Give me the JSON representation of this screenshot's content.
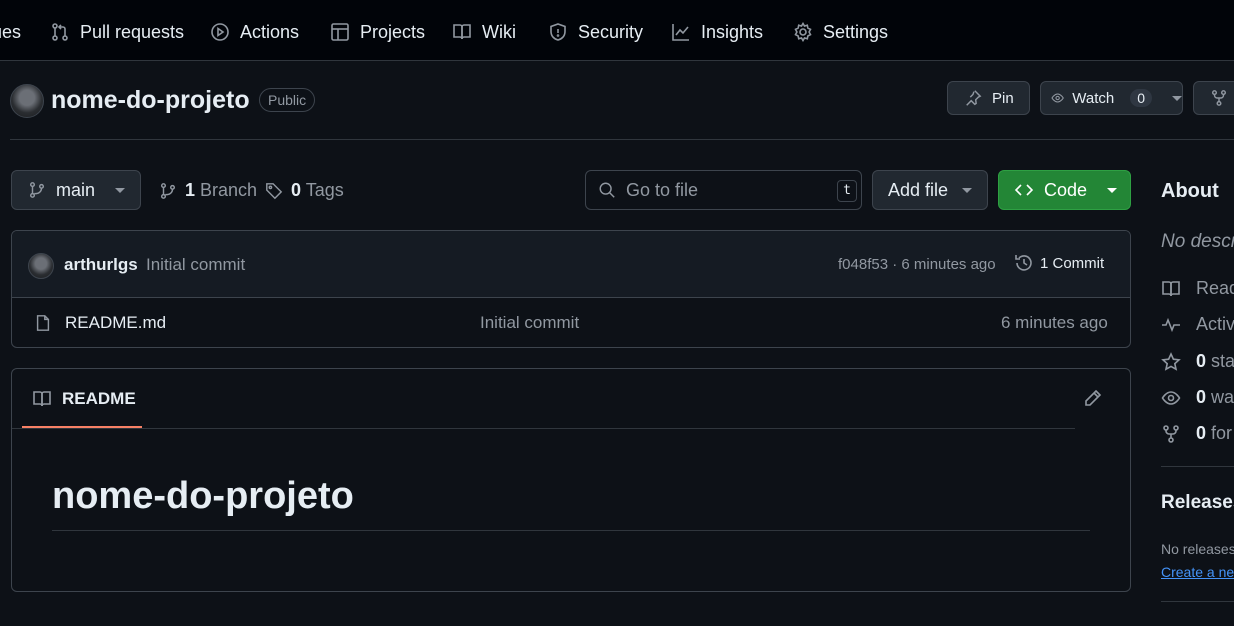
{
  "nav": {
    "items": [
      {
        "label": "ues",
        "icon": "issues-icon"
      },
      {
        "label": "Pull requests",
        "icon": "pull-request-icon"
      },
      {
        "label": "Actions",
        "icon": "play-icon"
      },
      {
        "label": "Projects",
        "icon": "table-icon"
      },
      {
        "label": "Wiki",
        "icon": "book-icon"
      },
      {
        "label": "Security",
        "icon": "shield-icon"
      },
      {
        "label": "Insights",
        "icon": "graph-icon"
      },
      {
        "label": "Settings",
        "icon": "gear-icon"
      }
    ]
  },
  "repo": {
    "name": "nome-do-projeto",
    "visibility": "Public",
    "pin_label": "Pin",
    "watch_label": "Watch",
    "watch_count": "0"
  },
  "toolbar": {
    "branch": "main",
    "branch_count": "1",
    "branch_label": "Branch",
    "tag_count": "0",
    "tag_label": "Tags",
    "search_placeholder": "Go to file",
    "search_shortcut": "t",
    "add_file_label": "Add file",
    "code_label": "Code"
  },
  "commit": {
    "author": "arthurlgs",
    "message": "Initial commit",
    "hash_time": "f048f53 · 6 minutes ago",
    "commits_label": "1 Commit"
  },
  "files": [
    {
      "name": "README.md",
      "message": "Initial commit",
      "time": "6 minutes ago"
    }
  ],
  "readme": {
    "tab_label": "README",
    "heading": "nome-do-projeto"
  },
  "sidebar": {
    "about_title": "About",
    "description": "No descr",
    "readme": "Read",
    "activity": "Activ",
    "stars_count": "0",
    "stars_label": "sta",
    "watchers_count": "0",
    "watchers_label": "wa",
    "forks_count": "0",
    "forks_label": "for",
    "releases_title": "Releases",
    "no_releases": "No releases",
    "create_link": "Create a ne"
  },
  "colors": {
    "background": "#0d1117",
    "code_button": "#238636",
    "link": "#4493f8",
    "tab_underline": "#f78166"
  }
}
